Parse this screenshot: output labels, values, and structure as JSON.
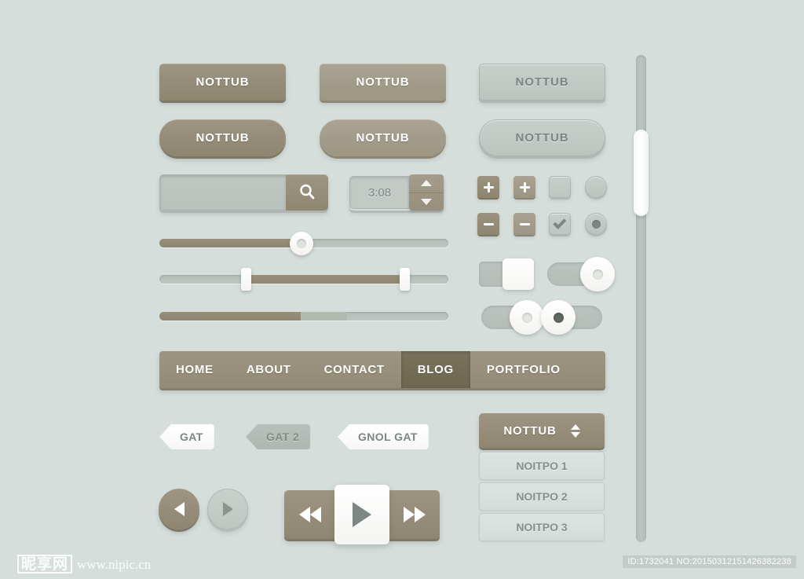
{
  "page": {
    "background": "#d6dedb",
    "accent_dark": "#8e866f",
    "accent_light": "#9e9784",
    "accent_active": "#6f6851",
    "gray": "#c2cac6",
    "gray_text": "#7d8682"
  },
  "buttons": {
    "rect_dark": "NOTTUB",
    "rect_light": "NOTTUB",
    "rect_gray": "NOTTUB",
    "pill_dark": "NOTTUB",
    "pill_light": "NOTTUB",
    "pill_gray": "NOTTUB"
  },
  "search": {
    "value": "",
    "placeholder": "",
    "icon": "search-icon"
  },
  "time_spinner": {
    "value": "3:08",
    "up_icon": "triangle-up-icon",
    "down_icon": "triangle-down-icon"
  },
  "steppers": {
    "plus_dark": "+",
    "plus_light": "+",
    "minus_dark": "-",
    "minus_light": "-"
  },
  "checkboxes": {
    "unchecked_label": "checkbox-unchecked",
    "checked_label": "checkbox-checked",
    "check_icon": "check-icon"
  },
  "radios": {
    "empty_label": "radio-empty",
    "selected_label": "radio-selected"
  },
  "sliders": [
    {
      "name": "single-handle-slider",
      "fill_percent": 49,
      "value": 49
    },
    {
      "name": "range-slider",
      "start_percent": 30,
      "end_percent": 85
    },
    {
      "name": "progress-slider",
      "fill_percent": 49,
      "buffer_percent": 65
    }
  ],
  "toggles": [
    {
      "name": "square-toggle",
      "state": "on"
    },
    {
      "name": "pill-toggle-on",
      "state": "on"
    },
    {
      "name": "pill-toggle-off",
      "state": "off"
    },
    {
      "name": "pill-toggle-filled",
      "state": "off-filled"
    }
  ],
  "navbar": {
    "items": [
      {
        "label": "HOME",
        "active": false
      },
      {
        "label": "ABOUT",
        "active": false
      },
      {
        "label": "CONTACT",
        "active": false
      },
      {
        "label": "BLOG",
        "active": true
      },
      {
        "label": "PORTFOLIO",
        "active": false
      }
    ]
  },
  "tags": [
    {
      "label": "GAT",
      "style": "white"
    },
    {
      "label": "GAT 2",
      "style": "gray"
    },
    {
      "label": "GNOL GAT",
      "style": "white"
    }
  ],
  "dropdown": {
    "selected": "NOTTUB",
    "arrows_icon": "chevron-updown-icon",
    "options": [
      "NOITPO 1",
      "NOITPO 2",
      "NOITPO 3"
    ]
  },
  "media": {
    "prev_circle": "previous-icon",
    "next_circle": "next-icon",
    "rewind": "rewind-icon",
    "play": "play-icon",
    "forward": "fast-forward-icon"
  },
  "scrollbar": {
    "name": "vertical-scrollbar",
    "thumb_position_percent": 17
  },
  "watermark": {
    "site_cn": "昵享网",
    "site_url": "www.nipic.cn",
    "id_text": "ID:1732041 NO:20150312151426382238"
  }
}
